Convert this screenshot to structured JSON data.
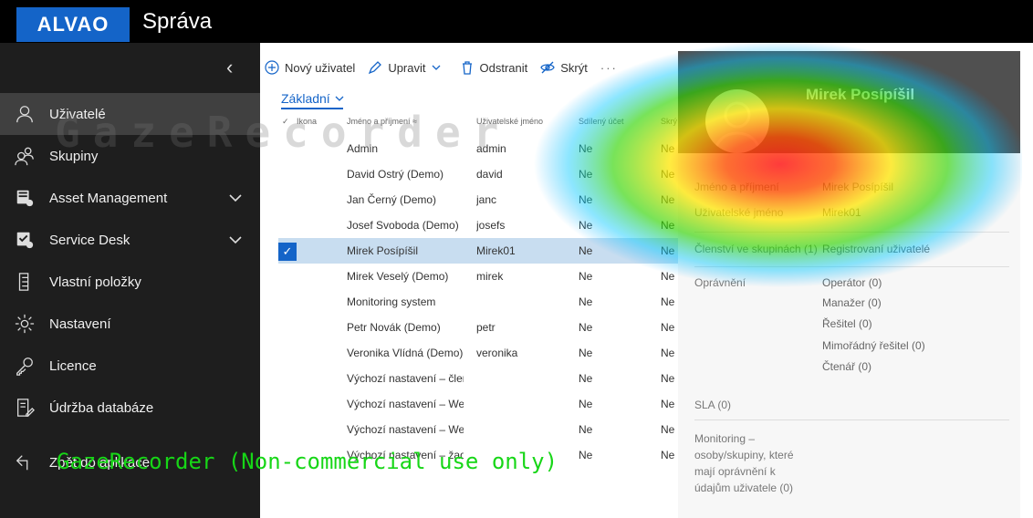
{
  "header": {
    "logo": "ALVAO",
    "title": "Správa"
  },
  "sidebar": {
    "items": [
      {
        "label": "Uživatelé",
        "icon": "user-icon"
      },
      {
        "label": "Skupiny",
        "icon": "group-icon"
      },
      {
        "label": "Asset Management",
        "icon": "asset-icon"
      },
      {
        "label": "Service Desk",
        "icon": "service-desk-icon"
      },
      {
        "label": "Vlastní položky",
        "icon": "custom-items-icon"
      },
      {
        "label": "Nastavení",
        "icon": "gear-icon"
      },
      {
        "label": "Licence",
        "icon": "key-icon"
      },
      {
        "label": "Údržba databáze",
        "icon": "database-maintenance-icon"
      },
      {
        "label": "Zpět do aplikace",
        "icon": "back-icon"
      }
    ]
  },
  "toolbar": {
    "new_user": "Nový uživatel",
    "edit": "Upravit",
    "delete": "Odstranit",
    "hide": "Skrýt",
    "more": "···"
  },
  "view": {
    "selected": "Základní"
  },
  "table": {
    "columns": [
      "Ikona",
      "Jméno a příjmení",
      "Uživatelské jméno",
      "Sdílený účet",
      "Skrý"
    ],
    "sort_indicator": "≈",
    "rows": [
      {
        "name": "Admin",
        "username": "admin",
        "shared": "Ne",
        "hidden": "Ne"
      },
      {
        "name": "David Ostrý (Demo)",
        "username": "david",
        "shared": "Ne",
        "hidden": "Ne"
      },
      {
        "name": "Jan Černý (Demo)",
        "username": "janc",
        "shared": "Ne",
        "hidden": "Ne"
      },
      {
        "name": "Josef Svoboda (Demo)",
        "username": "josefs",
        "shared": "Ne",
        "hidden": "Ne"
      },
      {
        "name": "Mirek Posípíšil",
        "username": "Mirek01",
        "shared": "Ne",
        "hidden": "Ne"
      },
      {
        "name": "Mirek Veselý (Demo)",
        "username": "mirek",
        "shared": "Ne",
        "hidden": "Ne"
      },
      {
        "name": "Monitoring system",
        "username": "",
        "shared": "Ne",
        "hidden": "Ne"
      },
      {
        "name": "Petr Novák (Demo)",
        "username": "petr",
        "shared": "Ne",
        "hidden": "Ne"
      },
      {
        "name": "Veronika Vlídná (Demo)",
        "username": "veronika",
        "shared": "Ne",
        "hidden": "Ne"
      },
      {
        "name": "Výchozí nastavení – člen",
        "username": "",
        "shared": "Ne",
        "hidden": "Ne"
      },
      {
        "name": "Výchozí nastavení – Wel",
        "username": "",
        "shared": "Ne",
        "hidden": "Ne"
      },
      {
        "name": "Výchozí nastavení – Wel",
        "username": "",
        "shared": "Ne",
        "hidden": "Ne"
      },
      {
        "name": "Výchozí nastavení – žad",
        "username": "",
        "shared": "Ne",
        "hidden": "Ne"
      }
    ],
    "selected_row": 4,
    "check_mark": "✓"
  },
  "detail": {
    "name": "Mirek Posípíšil",
    "fields": [
      {
        "label": "Jméno a příjmení",
        "value": "Mirek Posípíšil"
      },
      {
        "label": "Uživatelské jméno",
        "value": "Mirek01"
      },
      {
        "label": "Členství ve skupinách (1)",
        "value": "Registrovaní uživatelé"
      },
      {
        "label": "Oprávnění",
        "value": "Operátor (0)"
      }
    ],
    "permissions_extra": [
      "Manažer (0)",
      "Řešitel (0)",
      "Mimořádný řešitel (0)",
      "Čtenář (0)"
    ],
    "sla": "SLA (0)",
    "monitoring": [
      "Monitoring –",
      "osoby/skupiny, které",
      "mají oprávnění k",
      "údajům uživatele (0)"
    ]
  },
  "watermark": {
    "top": "GazeRecorder",
    "bottom": "GazeRecorder (Non-commercial use only)"
  },
  "colors": {
    "accent": "#1464c8",
    "sidebar": "#1e1e1e",
    "selected_row": "#c8ddf0",
    "watermark_green": "#17d617"
  }
}
